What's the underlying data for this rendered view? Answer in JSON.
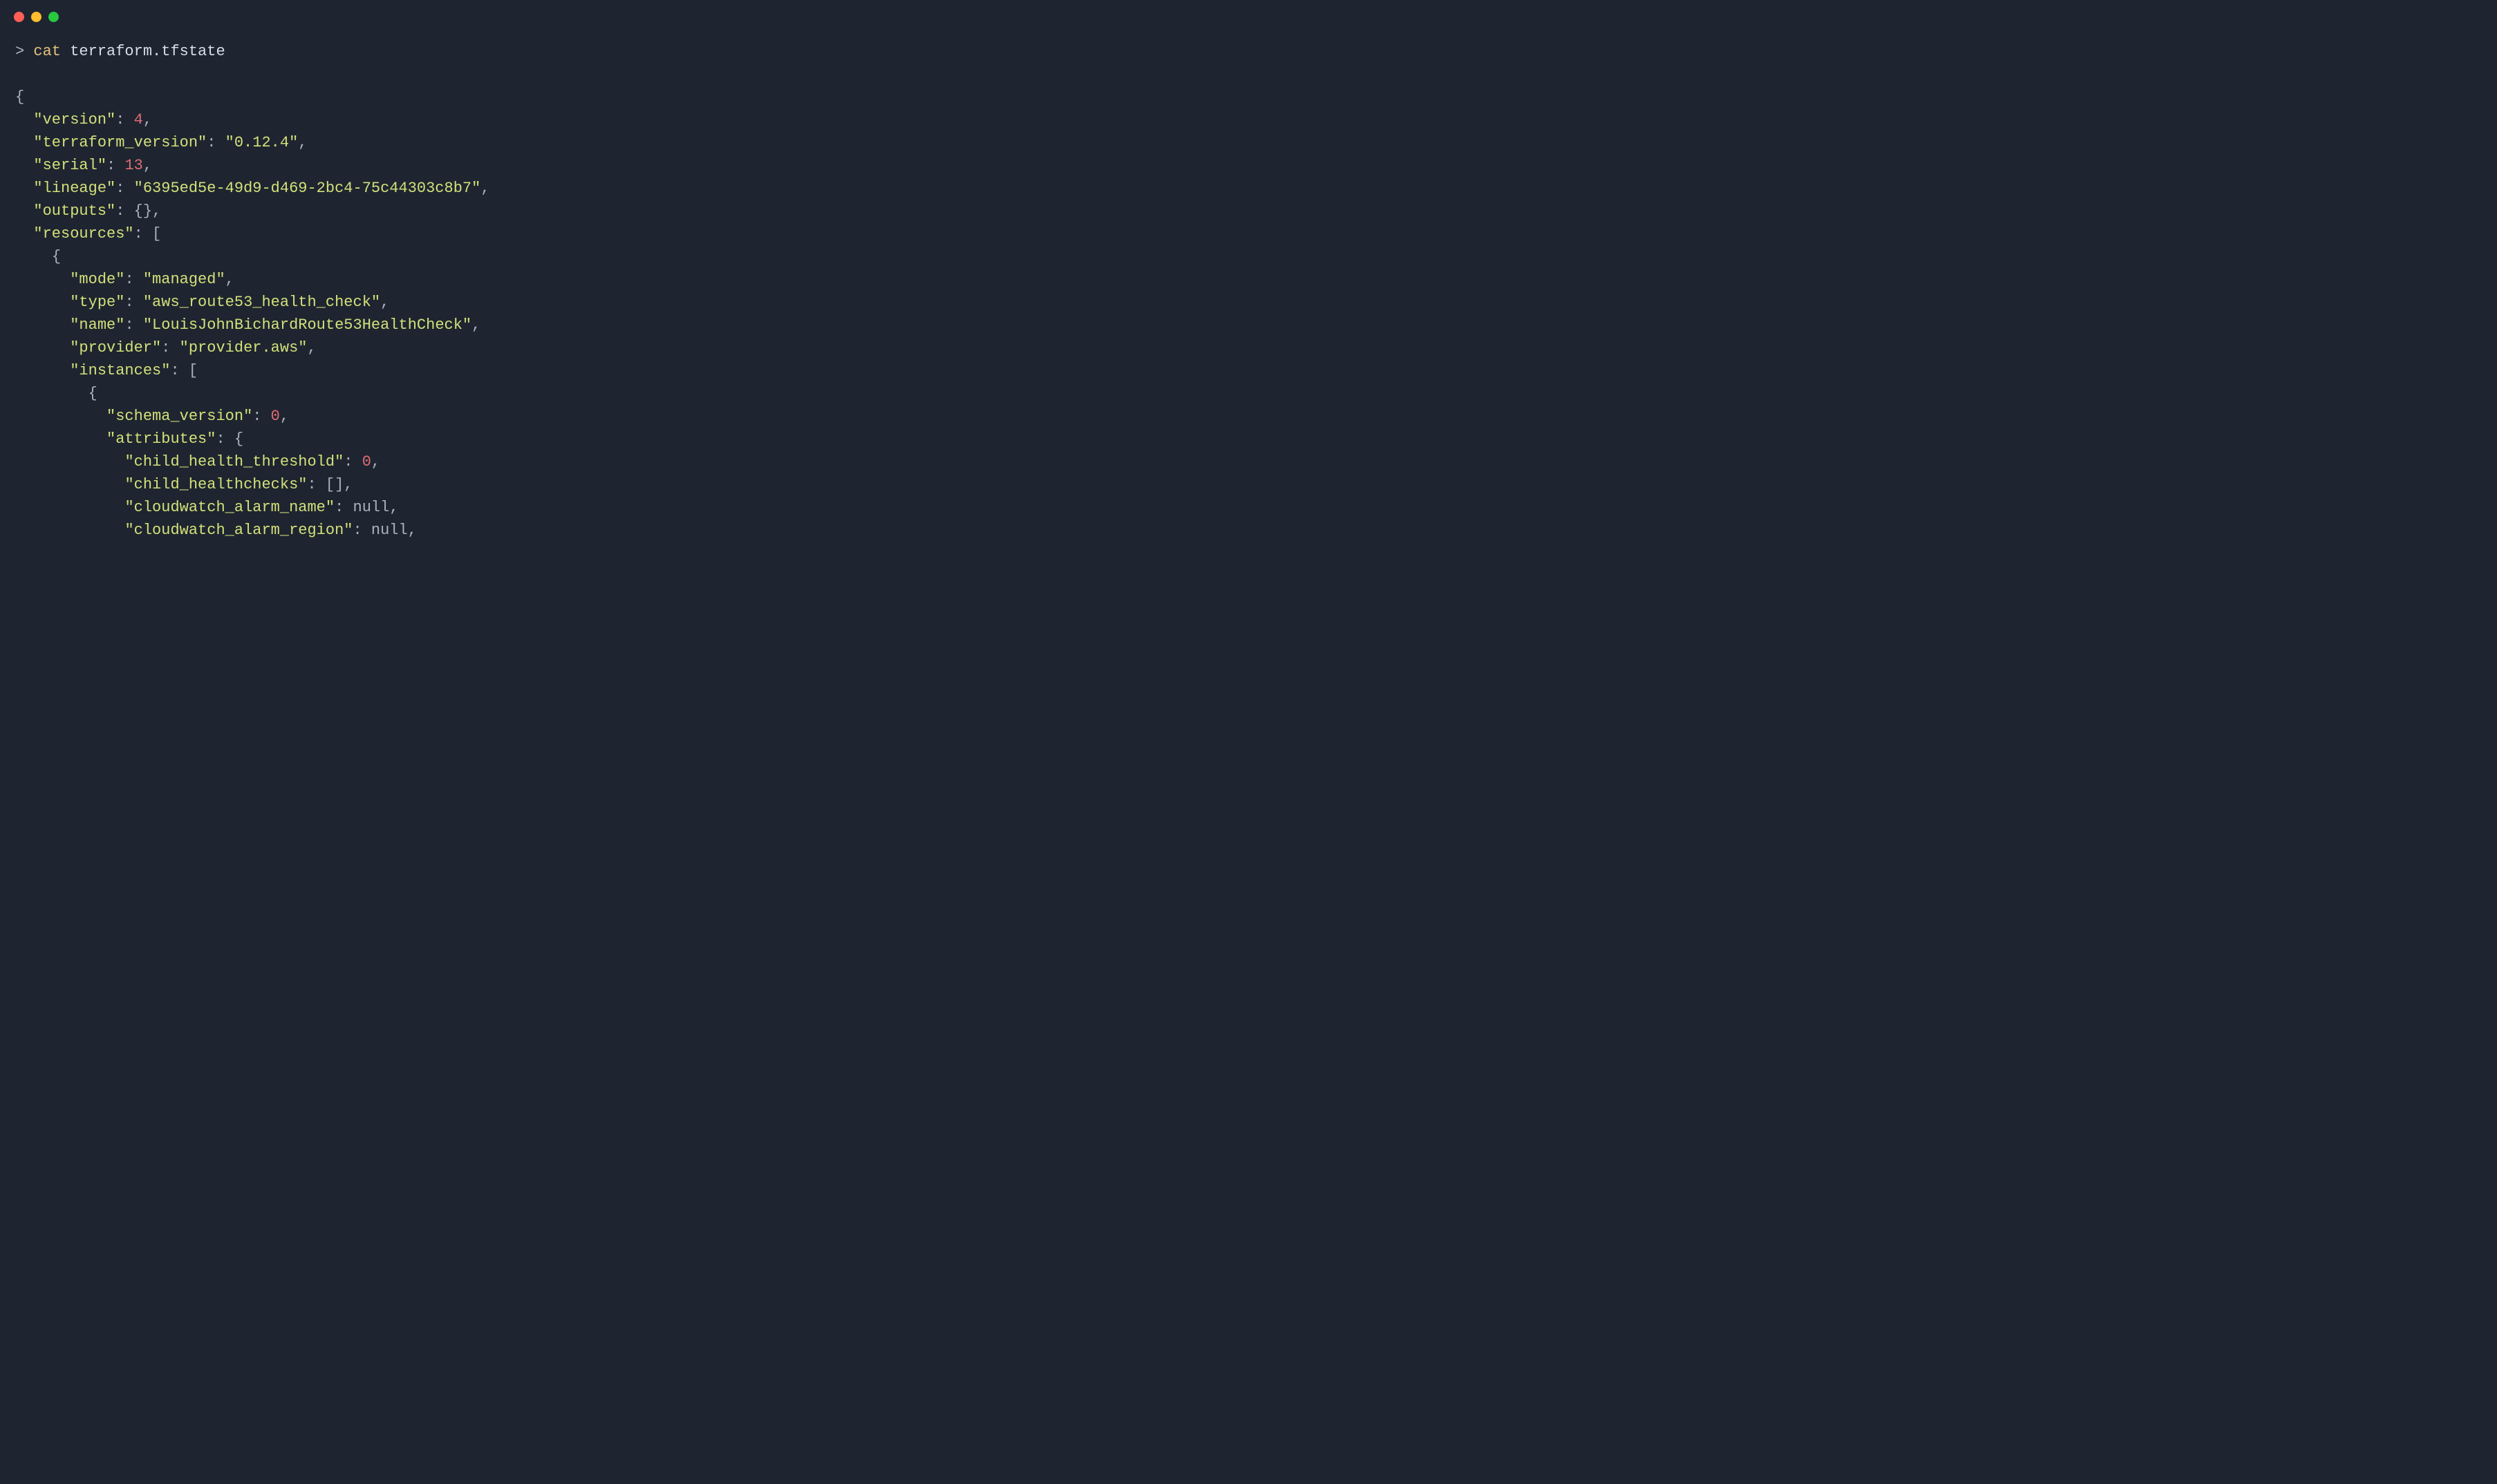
{
  "traffic_lights": {
    "red": "#ff5f57",
    "yellow": "#febc2e",
    "green": "#28c840"
  },
  "prompt": {
    "symbol": "> ",
    "command": "cat",
    "argument": " terraform.tfstate"
  },
  "json_keys": {
    "version": "\"version\"",
    "terraform_version": "\"terraform_version\"",
    "serial": "\"serial\"",
    "lineage": "\"lineage\"",
    "outputs": "\"outputs\"",
    "resources": "\"resources\"",
    "mode": "\"mode\"",
    "type": "\"type\"",
    "name": "\"name\"",
    "provider": "\"provider\"",
    "instances": "\"instances\"",
    "schema_version": "\"schema_version\"",
    "attributes": "\"attributes\"",
    "child_health_threshold": "\"child_health_threshold\"",
    "child_healthchecks": "\"child_healthchecks\"",
    "cloudwatch_alarm_name": "\"cloudwatch_alarm_name\"",
    "cloudwatch_alarm_region": "\"cloudwatch_alarm_region\""
  },
  "json_values": {
    "version": "4",
    "terraform_version": "\"0.12.4\"",
    "serial": "13",
    "lineage": "\"6395ed5e-49d9-d469-2bc4-75c44303c8b7\"",
    "mode": "\"managed\"",
    "type": "\"aws_route53_health_check\"",
    "name": "\"LouisJohnBichardRoute53HealthCheck\"",
    "provider": "\"provider.aws\"",
    "schema_version": "0",
    "child_health_threshold": "0",
    "null": "null"
  },
  "punct": {
    "open_brace": "{",
    "close_brace": "}",
    "open_bracket": "[",
    "close_bracket": "]",
    "colon_space": ": ",
    "comma": ",",
    "empty_obj": "{}",
    "empty_arr": "[]"
  },
  "indent": {
    "l1": "  ",
    "l2": "    ",
    "l3": "      ",
    "l4": "        ",
    "l5": "          ",
    "l6": "            "
  }
}
